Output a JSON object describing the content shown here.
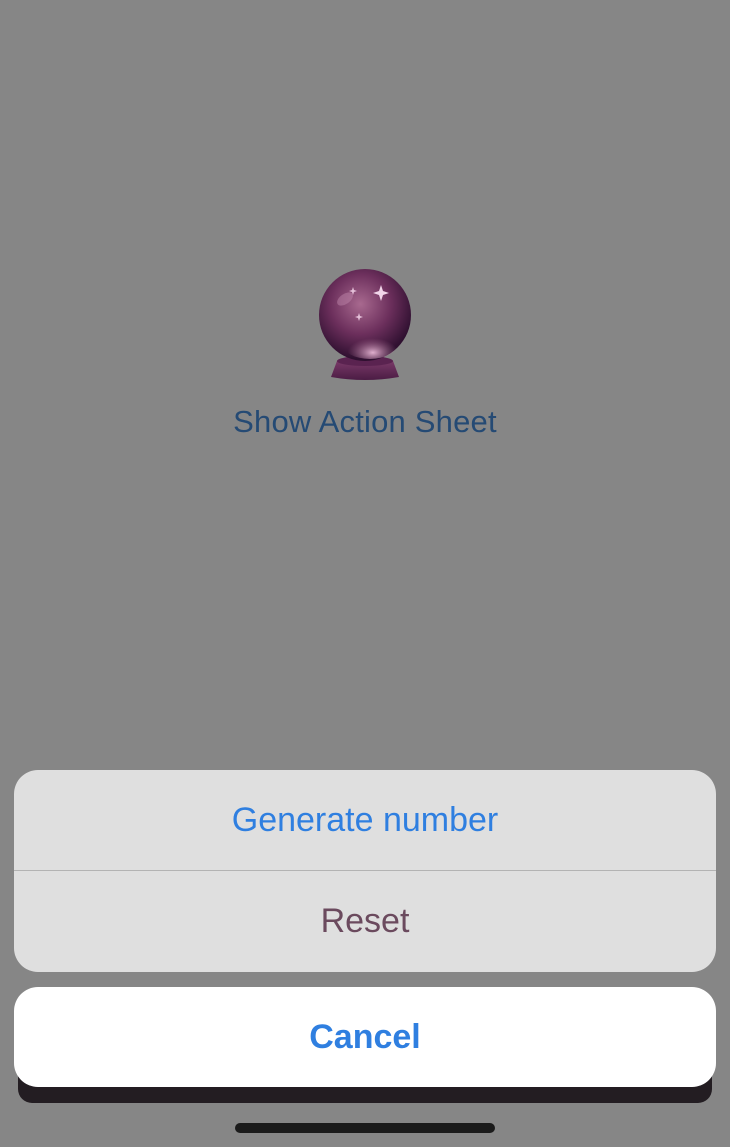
{
  "main": {
    "crystal_ball_icon": "crystal-ball-icon",
    "show_action_sheet_label": "Show Action Sheet"
  },
  "action_sheet": {
    "actions": [
      {
        "label": "Generate number",
        "color": "#2f7fe0"
      },
      {
        "label": "Reset",
        "color": "#6b4a5e"
      }
    ],
    "cancel_label": "Cancel"
  },
  "colors": {
    "backdrop": "#868686",
    "accent": "#2f7fe0",
    "sheet_background": "#dfdfdf",
    "cancel_background": "#ffffff"
  }
}
